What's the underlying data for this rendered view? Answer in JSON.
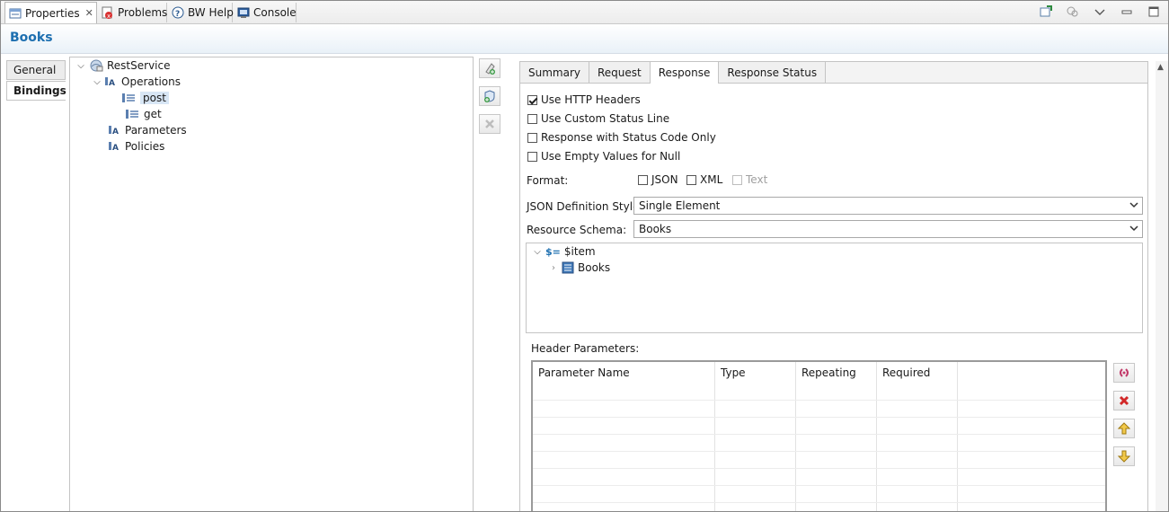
{
  "view_tabs": [
    {
      "label": "Properties",
      "icon": "properties-icon",
      "active": true
    },
    {
      "label": "Problems",
      "icon": "problems-icon"
    },
    {
      "label": "BW Help",
      "icon": "help-icon"
    },
    {
      "label": "Console",
      "icon": "console-icon"
    }
  ],
  "view_close_glyph": "✕",
  "header": {
    "title": "Books"
  },
  "left_tabs": [
    {
      "label": "General"
    },
    {
      "label": "Bindings",
      "active": true
    }
  ],
  "tree": {
    "root": "RestService",
    "operations": "Operations",
    "post": "post",
    "get": "get",
    "parameters": "Parameters",
    "policies": "Policies"
  },
  "response_tabs": [
    {
      "label": "Summary"
    },
    {
      "label": "Request"
    },
    {
      "label": "Response",
      "active": true
    },
    {
      "label": "Response Status"
    }
  ],
  "options": {
    "use_http_headers": {
      "label": "Use HTTP Headers",
      "checked": true
    },
    "use_custom_status_line": {
      "label": "Use Custom Status Line",
      "checked": false
    },
    "status_code_only": {
      "label": "Response with Status Code Only",
      "checked": false
    },
    "empty_values_null": {
      "label": "Use Empty Values for Null",
      "checked": false
    }
  },
  "format": {
    "label": "Format:",
    "json": "JSON",
    "xml": "XML",
    "text": "Text"
  },
  "json_style": {
    "label": "JSON Definition Style:",
    "value": "Single Element"
  },
  "resource_schema": {
    "label": "Resource Schema:",
    "value": "Books"
  },
  "schema_tree": {
    "item": "$item",
    "item_prefix": "$=",
    "books": "Books"
  },
  "header_params": {
    "label": "Header Parameters:",
    "columns": [
      "Parameter Name",
      "Type",
      "Repeating",
      "Required"
    ]
  },
  "colors": {
    "accent": "#1d6fb0",
    "selection": "#d8e6f5"
  }
}
